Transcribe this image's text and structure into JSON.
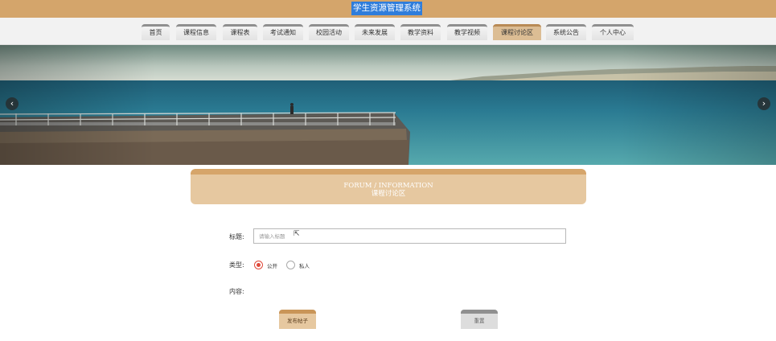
{
  "header": {
    "site_title": "学生资源管理系统"
  },
  "nav": {
    "items": [
      {
        "label": "首页"
      },
      {
        "label": "课程信息"
      },
      {
        "label": "课程表"
      },
      {
        "label": "考试通知"
      },
      {
        "label": "校园活动"
      },
      {
        "label": "未来发展"
      },
      {
        "label": "教学资料"
      },
      {
        "label": "教学视频"
      },
      {
        "label": "课程讨论区",
        "active": true
      },
      {
        "label": "系统公告"
      },
      {
        "label": "个人中心"
      }
    ]
  },
  "banner": {
    "prev_icon": "‹",
    "next_icon": "›"
  },
  "section": {
    "title_en": "FORUM / INFORMATION",
    "title_zh": "课程讨论区"
  },
  "form": {
    "title_label": "标题:",
    "title_placeholder": "请输入标题",
    "title_value": "",
    "type_label": "类型:",
    "type_options": [
      {
        "label": "公开",
        "selected": true
      },
      {
        "label": "私人",
        "selected": false
      }
    ],
    "content_label": "内容:",
    "submit_label": "发布帖子",
    "reset_label": "重置"
  },
  "colors": {
    "accent": "#d4a56b",
    "title_highlight": "#2f7ddb",
    "radio_selected": "#e0493a"
  }
}
